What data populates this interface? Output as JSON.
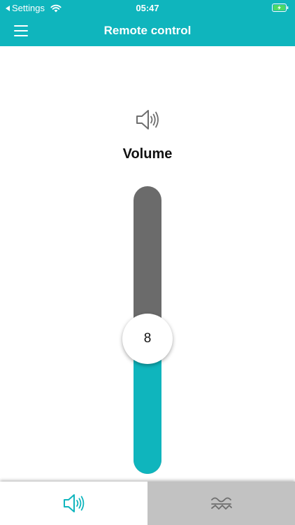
{
  "status_bar": {
    "back_label": "Settings",
    "time": "05:47"
  },
  "nav": {
    "title": "Remote control",
    "menu_icon": "hamburger-menu-icon"
  },
  "volume": {
    "icon": "speaker-volume-icon",
    "title": "Volume",
    "value": "8",
    "level_fraction": 0.47
  },
  "tabs": [
    {
      "name": "volume",
      "icon": "speaker-volume-icon",
      "active": true
    },
    {
      "name": "wave",
      "icon": "wave-icon",
      "active": false
    }
  ],
  "colors": {
    "accent": "#0fb5bd",
    "track_empty": "#6b6b6b",
    "inactive_tab": "#c2c2c2",
    "icon_gray": "#6e6e6e"
  }
}
